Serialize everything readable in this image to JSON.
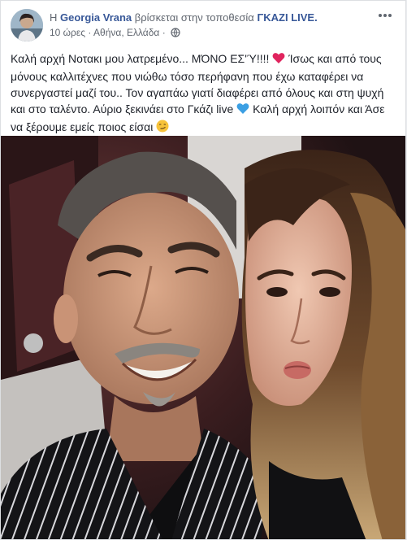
{
  "post": {
    "author_prefix": "Η",
    "author_name": "Georgia Vrana",
    "location_text": "βρίσκεται στην τοποθεσία",
    "location_name": "ΓΚΑΖΙ LIVE.",
    "time": "10 ώρες",
    "separator": "·",
    "place": "Αθήνα, Ελλάδα",
    "privacy_icon": "globe-icon",
    "more_icon": "more-options-icon",
    "text_part1": "Καλή αρχή Νοτακι μου λατρεμένο... ΜΌΝΟ ΕΣ'Ύ!!!!",
    "text_part2": "Ίσως και από τους μόνους καλλιτέχνες που νιώθω τόσο περήφανη που έχω καταφέρει να συνεργαστεί μαζί του.. Τον αγαπάω γιατί διαφέρει από όλους και στη ψυχή και στο ταλέντο. Αύριο ξεκινάει στο Γκάζι live",
    "text_part3": "Καλή αρχή λοιπόν και Άσε να ξέρουμε εμείς ποιος είσαι",
    "emoji_1": "red-heart-icon",
    "emoji_2": "blue-heart-icon",
    "emoji_3": "smirk-face-icon"
  },
  "colors": {
    "link": "#385898",
    "text": "#1d2129",
    "meta": "#616770",
    "heart_red": "#e0245e",
    "heart_blue": "#3b9fe3"
  }
}
